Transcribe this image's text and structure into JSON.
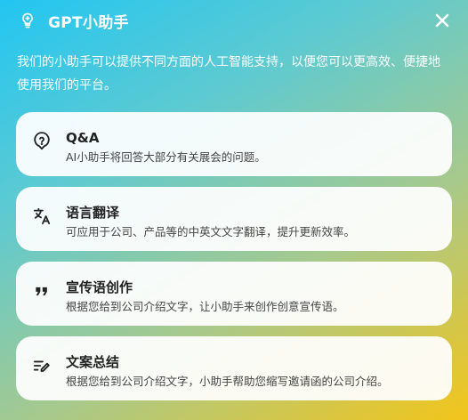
{
  "header": {
    "title": "GPT小助手",
    "logo_icon": "brain-bulb-icon",
    "close_icon": "close-icon"
  },
  "intro": "我们的小助手可以提供不同方面的人工智能支持，以便您可以更高效、便捷地使用我们的平台。",
  "cards": [
    {
      "title": "Q&A",
      "desc": "AI小助手将回答大部分有关展会的问题。",
      "icon": "question-bubble-icon"
    },
    {
      "title": "语言翻译",
      "desc": "可应用于公司、产品等的中英文文字翻译，提升更新效率。",
      "icon": "translate-icon"
    },
    {
      "title": "宣传语创作",
      "desc": "根据您给到公司介绍文字，让小助手来创作创意宣传语。",
      "icon": "quote-icon"
    },
    {
      "title": "文案总结",
      "desc": "根据您给到公司介绍文字，小助手帮助您缩写邀请函的公司介绍。",
      "icon": "edit-notes-icon"
    }
  ]
}
